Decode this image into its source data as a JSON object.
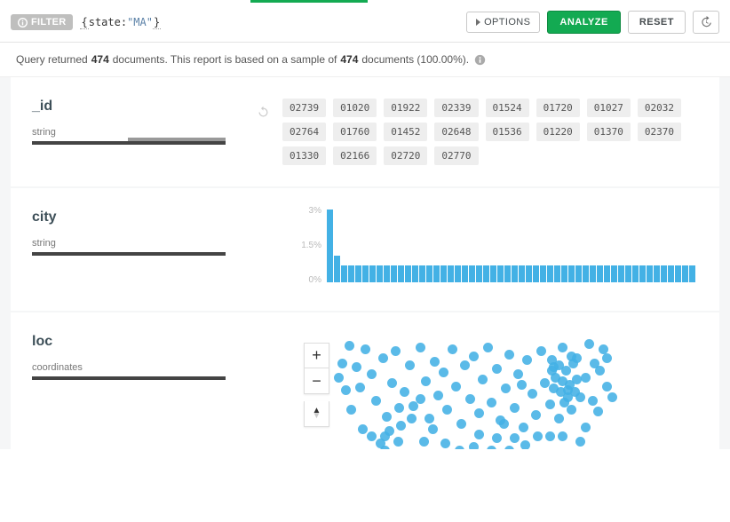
{
  "query_bar": {
    "filter_label": "FILTER",
    "query_brace_open": "{",
    "query_key": "state",
    "query_colon": ":",
    "query_value": "\"MA\"",
    "query_brace_close": "}",
    "options_label": "OPTIONS",
    "analyze_label": "ANALYZE",
    "reset_label": "RESET"
  },
  "summary": {
    "prefix": "Query returned ",
    "count1": "474",
    "mid1": " documents. This report is based on a sample of ",
    "count2": "474",
    "suffix": " documents (100.00%)."
  },
  "fields": {
    "id": {
      "name": "_id",
      "type": "string",
      "tags": [
        "02739",
        "01020",
        "01922",
        "02339",
        "01524",
        "01720",
        "01027",
        "02032",
        "02764",
        "01760",
        "01452",
        "02648",
        "01536",
        "01220",
        "01370",
        "02370",
        "01330",
        "02166",
        "02720",
        "02770"
      ]
    },
    "city": {
      "name": "city",
      "type": "string"
    },
    "loc": {
      "name": "loc",
      "type": "coordinates",
      "zoom_in": "+",
      "zoom_out": "−"
    }
  },
  "chart_data": {
    "type": "bar",
    "title": "",
    "xlabel": "",
    "ylabel": "",
    "ylim": [
      0,
      3
    ],
    "y_ticks": [
      "3%",
      "1.5%",
      "0%"
    ],
    "categories_count": 52,
    "values": [
      3.0,
      1.1,
      0.7,
      0.7,
      0.7,
      0.7,
      0.7,
      0.7,
      0.7,
      0.7,
      0.7,
      0.7,
      0.7,
      0.7,
      0.7,
      0.7,
      0.7,
      0.7,
      0.7,
      0.7,
      0.7,
      0.7,
      0.7,
      0.7,
      0.7,
      0.7,
      0.7,
      0.7,
      0.7,
      0.7,
      0.7,
      0.7,
      0.7,
      0.7,
      0.7,
      0.7,
      0.7,
      0.7,
      0.7,
      0.7,
      0.7,
      0.7,
      0.7,
      0.7,
      0.7,
      0.7,
      0.7,
      0.7,
      0.7,
      0.7,
      0.7,
      0.7
    ]
  },
  "map_points": [
    [
      70,
      8
    ],
    [
      78,
      32
    ],
    [
      82,
      55
    ],
    [
      88,
      12
    ],
    [
      95,
      40
    ],
    [
      100,
      70
    ],
    [
      108,
      22
    ],
    [
      112,
      88
    ],
    [
      118,
      50
    ],
    [
      122,
      14
    ],
    [
      128,
      98
    ],
    [
      132,
      60
    ],
    [
      138,
      30
    ],
    [
      142,
      76
    ],
    [
      110,
      110
    ],
    [
      150,
      10
    ],
    [
      156,
      48
    ],
    [
      160,
      90
    ],
    [
      166,
      26
    ],
    [
      170,
      64
    ],
    [
      176,
      38
    ],
    [
      180,
      80
    ],
    [
      186,
      12
    ],
    [
      190,
      54
    ],
    [
      196,
      96
    ],
    [
      200,
      30
    ],
    [
      206,
      68
    ],
    [
      210,
      20
    ],
    [
      216,
      84
    ],
    [
      220,
      46
    ],
    [
      226,
      10
    ],
    [
      230,
      72
    ],
    [
      236,
      34
    ],
    [
      240,
      92
    ],
    [
      246,
      56
    ],
    [
      250,
      18
    ],
    [
      256,
      78
    ],
    [
      260,
      40
    ],
    [
      266,
      100
    ],
    [
      270,
      24
    ],
    [
      276,
      62
    ],
    [
      280,
      86
    ],
    [
      286,
      14
    ],
    [
      290,
      50
    ],
    [
      296,
      74
    ],
    [
      300,
      32
    ],
    [
      306,
      90
    ],
    [
      310,
      10
    ],
    [
      316,
      58
    ],
    [
      320,
      80
    ],
    [
      326,
      22
    ],
    [
      330,
      66
    ],
    [
      336,
      44
    ],
    [
      310,
      110
    ],
    [
      346,
      28
    ],
    [
      350,
      82
    ],
    [
      356,
      12
    ],
    [
      360,
      54
    ],
    [
      296,
      110
    ],
    [
      85,
      102
    ],
    [
      95,
      110
    ],
    [
      105,
      118
    ],
    [
      115,
      104
    ],
    [
      125,
      116
    ],
    [
      110,
      126
    ],
    [
      298,
      36
    ],
    [
      302,
      44
    ],
    [
      306,
      30
    ],
    [
      310,
      48
    ],
    [
      314,
      36
    ],
    [
      318,
      52
    ],
    [
      322,
      28
    ],
    [
      326,
      46
    ],
    [
      308,
      60
    ],
    [
      316,
      66
    ],
    [
      300,
      56
    ],
    [
      324,
      60
    ],
    [
      312,
      72
    ],
    [
      298,
      24
    ],
    [
      320,
      20
    ],
    [
      150,
      68
    ],
    [
      164,
      102
    ],
    [
      178,
      118
    ],
    [
      140,
      90
    ],
    [
      154,
      116
    ],
    [
      126,
      78
    ],
    [
      256,
      112
    ],
    [
      236,
      112
    ],
    [
      216,
      108
    ],
    [
      244,
      96
    ],
    [
      264,
      52
    ],
    [
      340,
      6
    ],
    [
      352,
      36
    ],
    [
      360,
      22
    ],
    [
      344,
      70
    ],
    [
      336,
      100
    ],
    [
      282,
      110
    ],
    [
      268,
      120
    ],
    [
      250,
      126
    ],
    [
      230,
      126
    ],
    [
      210,
      122
    ],
    [
      194,
      126
    ],
    [
      62,
      28
    ],
    [
      66,
      58
    ],
    [
      72,
      80
    ],
    [
      58,
      44
    ],
    [
      366,
      66
    ],
    [
      330,
      116
    ]
  ]
}
